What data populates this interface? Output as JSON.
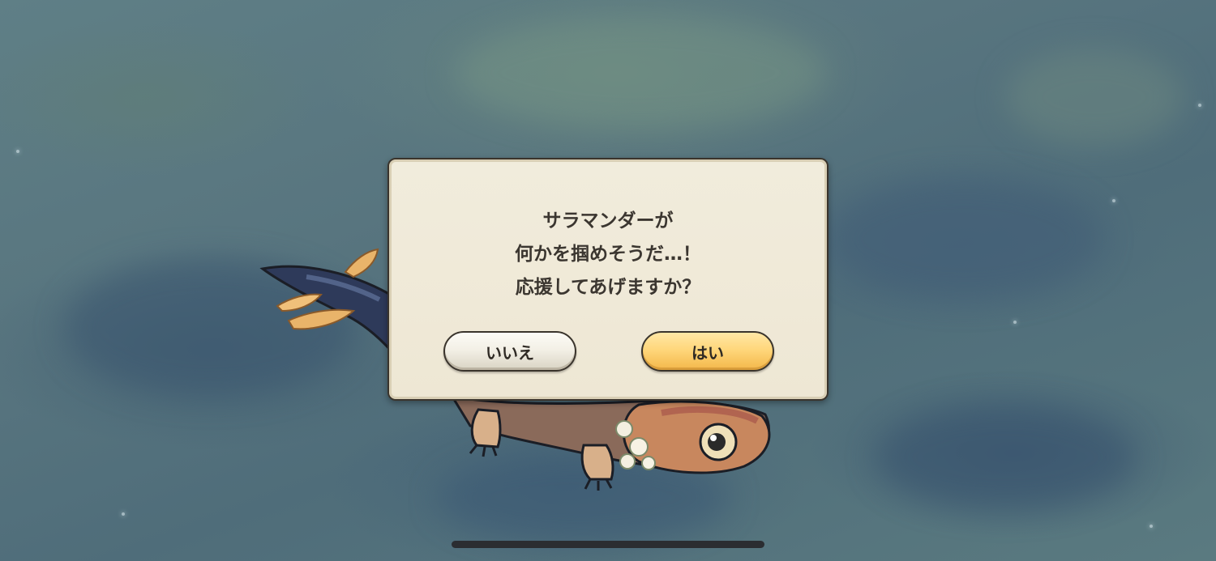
{
  "dialog": {
    "message_lines": [
      "サラマンダーが",
      "何かを掴めそうだ…！",
      "応援してあげますか？"
    ],
    "no_label": "いいえ",
    "yes_label": "はい"
  },
  "colors": {
    "dialog_background": "#efe9d8",
    "dialog_border": "#3a342c",
    "yes_button": "#ffd77b",
    "no_button": "#f3f0e6",
    "text": "#3b3630"
  }
}
